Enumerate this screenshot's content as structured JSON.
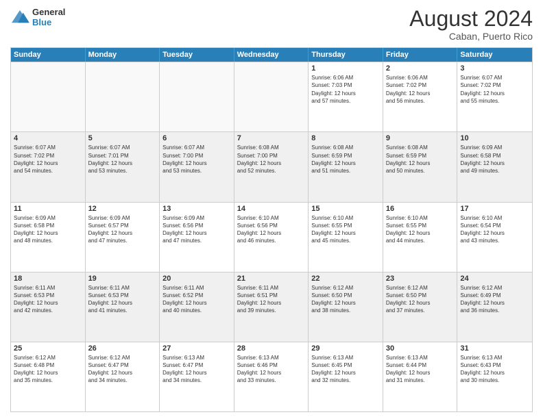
{
  "logo": {
    "line1": "General",
    "line2": "Blue"
  },
  "title": "August 2024",
  "subtitle": "Caban, Puerto Rico",
  "days": [
    "Sunday",
    "Monday",
    "Tuesday",
    "Wednesday",
    "Thursday",
    "Friday",
    "Saturday"
  ],
  "rows": [
    [
      {
        "day": "",
        "info": "",
        "empty": true
      },
      {
        "day": "",
        "info": "",
        "empty": true
      },
      {
        "day": "",
        "info": "",
        "empty": true
      },
      {
        "day": "",
        "info": "",
        "empty": true
      },
      {
        "day": "1",
        "info": "Sunrise: 6:06 AM\nSunset: 7:03 PM\nDaylight: 12 hours\nand 57 minutes."
      },
      {
        "day": "2",
        "info": "Sunrise: 6:06 AM\nSunset: 7:02 PM\nDaylight: 12 hours\nand 56 minutes."
      },
      {
        "day": "3",
        "info": "Sunrise: 6:07 AM\nSunset: 7:02 PM\nDaylight: 12 hours\nand 55 minutes."
      }
    ],
    [
      {
        "day": "4",
        "info": "Sunrise: 6:07 AM\nSunset: 7:02 PM\nDaylight: 12 hours\nand 54 minutes.",
        "shaded": true
      },
      {
        "day": "5",
        "info": "Sunrise: 6:07 AM\nSunset: 7:01 PM\nDaylight: 12 hours\nand 53 minutes.",
        "shaded": true
      },
      {
        "day": "6",
        "info": "Sunrise: 6:07 AM\nSunset: 7:00 PM\nDaylight: 12 hours\nand 53 minutes.",
        "shaded": true
      },
      {
        "day": "7",
        "info": "Sunrise: 6:08 AM\nSunset: 7:00 PM\nDaylight: 12 hours\nand 52 minutes.",
        "shaded": true
      },
      {
        "day": "8",
        "info": "Sunrise: 6:08 AM\nSunset: 6:59 PM\nDaylight: 12 hours\nand 51 minutes.",
        "shaded": true
      },
      {
        "day": "9",
        "info": "Sunrise: 6:08 AM\nSunset: 6:59 PM\nDaylight: 12 hours\nand 50 minutes.",
        "shaded": true
      },
      {
        "day": "10",
        "info": "Sunrise: 6:09 AM\nSunset: 6:58 PM\nDaylight: 12 hours\nand 49 minutes.",
        "shaded": true
      }
    ],
    [
      {
        "day": "11",
        "info": "Sunrise: 6:09 AM\nSunset: 6:58 PM\nDaylight: 12 hours\nand 48 minutes."
      },
      {
        "day": "12",
        "info": "Sunrise: 6:09 AM\nSunset: 6:57 PM\nDaylight: 12 hours\nand 47 minutes."
      },
      {
        "day": "13",
        "info": "Sunrise: 6:09 AM\nSunset: 6:56 PM\nDaylight: 12 hours\nand 47 minutes."
      },
      {
        "day": "14",
        "info": "Sunrise: 6:10 AM\nSunset: 6:56 PM\nDaylight: 12 hours\nand 46 minutes."
      },
      {
        "day": "15",
        "info": "Sunrise: 6:10 AM\nSunset: 6:55 PM\nDaylight: 12 hours\nand 45 minutes."
      },
      {
        "day": "16",
        "info": "Sunrise: 6:10 AM\nSunset: 6:55 PM\nDaylight: 12 hours\nand 44 minutes."
      },
      {
        "day": "17",
        "info": "Sunrise: 6:10 AM\nSunset: 6:54 PM\nDaylight: 12 hours\nand 43 minutes."
      }
    ],
    [
      {
        "day": "18",
        "info": "Sunrise: 6:11 AM\nSunset: 6:53 PM\nDaylight: 12 hours\nand 42 minutes.",
        "shaded": true
      },
      {
        "day": "19",
        "info": "Sunrise: 6:11 AM\nSunset: 6:53 PM\nDaylight: 12 hours\nand 41 minutes.",
        "shaded": true
      },
      {
        "day": "20",
        "info": "Sunrise: 6:11 AM\nSunset: 6:52 PM\nDaylight: 12 hours\nand 40 minutes.",
        "shaded": true
      },
      {
        "day": "21",
        "info": "Sunrise: 6:11 AM\nSunset: 6:51 PM\nDaylight: 12 hours\nand 39 minutes.",
        "shaded": true
      },
      {
        "day": "22",
        "info": "Sunrise: 6:12 AM\nSunset: 6:50 PM\nDaylight: 12 hours\nand 38 minutes.",
        "shaded": true
      },
      {
        "day": "23",
        "info": "Sunrise: 6:12 AM\nSunset: 6:50 PM\nDaylight: 12 hours\nand 37 minutes.",
        "shaded": true
      },
      {
        "day": "24",
        "info": "Sunrise: 6:12 AM\nSunset: 6:49 PM\nDaylight: 12 hours\nand 36 minutes.",
        "shaded": true
      }
    ],
    [
      {
        "day": "25",
        "info": "Sunrise: 6:12 AM\nSunset: 6:48 PM\nDaylight: 12 hours\nand 35 minutes."
      },
      {
        "day": "26",
        "info": "Sunrise: 6:12 AM\nSunset: 6:47 PM\nDaylight: 12 hours\nand 34 minutes."
      },
      {
        "day": "27",
        "info": "Sunrise: 6:13 AM\nSunset: 6:47 PM\nDaylight: 12 hours\nand 34 minutes."
      },
      {
        "day": "28",
        "info": "Sunrise: 6:13 AM\nSunset: 6:46 PM\nDaylight: 12 hours\nand 33 minutes."
      },
      {
        "day": "29",
        "info": "Sunrise: 6:13 AM\nSunset: 6:45 PM\nDaylight: 12 hours\nand 32 minutes."
      },
      {
        "day": "30",
        "info": "Sunrise: 6:13 AM\nSunset: 6:44 PM\nDaylight: 12 hours\nand 31 minutes."
      },
      {
        "day": "31",
        "info": "Sunrise: 6:13 AM\nSunset: 6:43 PM\nDaylight: 12 hours\nand 30 minutes."
      }
    ]
  ]
}
